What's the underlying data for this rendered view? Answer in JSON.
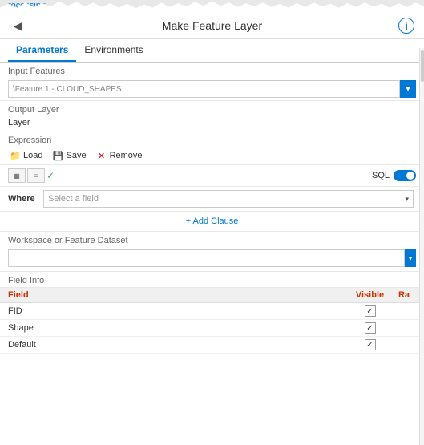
{
  "header": {
    "title": "Make Feature Layer",
    "back_icon": "◀",
    "info_icon": "i",
    "left_link": "rocessing"
  },
  "tabs": {
    "items": [
      {
        "id": "parameters",
        "label": "Parameters",
        "active": true
      },
      {
        "id": "environments",
        "label": "Environments",
        "active": false
      }
    ]
  },
  "input_features": {
    "label": "Input Features",
    "value": "\\Feature 1 - CLOUD_SHAPES",
    "placeholder": ""
  },
  "output_layer": {
    "label": "Output Layer",
    "value": "Layer"
  },
  "expression": {
    "label": "Expression",
    "load_label": "Load",
    "save_label": "Save",
    "remove_label": "Remove"
  },
  "sql_builder": {
    "sql_label": "SQL",
    "where_label": "Where",
    "field_placeholder": "Select a field"
  },
  "add_clause": {
    "label": "+ Add Clause"
  },
  "workspace": {
    "label": "Workspace or Feature Dataset"
  },
  "field_info": {
    "label": "Field Info",
    "columns": {
      "field": "Field",
      "visible": "Visible",
      "ra": "Ra"
    },
    "rows": [
      {
        "field": "FID",
        "visible": true,
        "ra": false
      },
      {
        "field": "Shape",
        "visible": true,
        "ra": false
      },
      {
        "field": "Default",
        "visible": true,
        "ra": false
      }
    ]
  }
}
